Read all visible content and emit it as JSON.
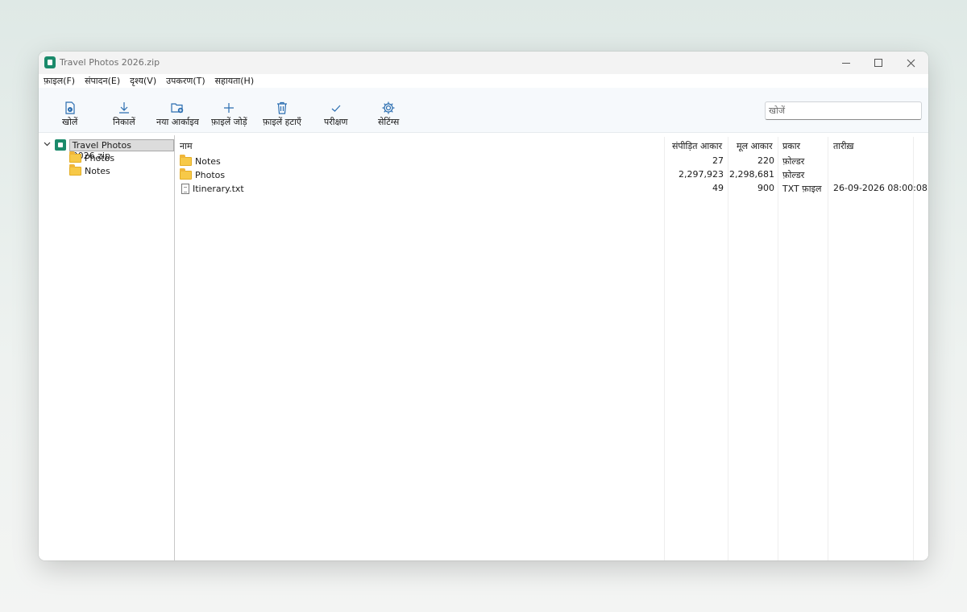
{
  "window": {
    "title": "Travel Photos 2026.zip"
  },
  "menu": [
    "फ़ाइल(F)",
    "संपादन(E)",
    "दृश्य(V)",
    "उपकरण(T)",
    "सहायता(H)"
  ],
  "toolbar": {
    "open": "खोलें",
    "extract": "निकालें",
    "new_archive": "नया आर्काइव",
    "add_files": "फ़ाइलें जोड़ें",
    "remove_files": "फ़ाइलें हटाएँ",
    "test": "परीक्षण",
    "settings": "सेटिंग्स",
    "search_placeholder": "खोजें"
  },
  "tree": {
    "root": "Travel Photos 2026.zip",
    "children": [
      "Photos",
      "Notes"
    ]
  },
  "list": {
    "columns": {
      "name": "नाम",
      "compressed": "संपीड़ित आकार",
      "original": "मूल आकार",
      "type": "प्रकार",
      "date": "तारीख़"
    },
    "rows": [
      {
        "name": "Notes",
        "compressed": "27",
        "original": "220",
        "type": "फ़ोल्डर",
        "date": "",
        "icon": "folder-icon"
      },
      {
        "name": "Photos",
        "compressed": "2,297,923",
        "original": "2,298,681",
        "type": "फ़ोल्डर",
        "date": "",
        "icon": "folder-icon"
      },
      {
        "name": "Itinerary.txt",
        "compressed": "49",
        "original": "900",
        "type": "TXT फ़ाइल",
        "date": "26-09-2026 08:00:08",
        "icon": "text-file-icon"
      }
    ]
  },
  "colors": {
    "accent": "#2a6db0",
    "app_icon": "#1b8a6b",
    "folder": "#f7c948"
  }
}
